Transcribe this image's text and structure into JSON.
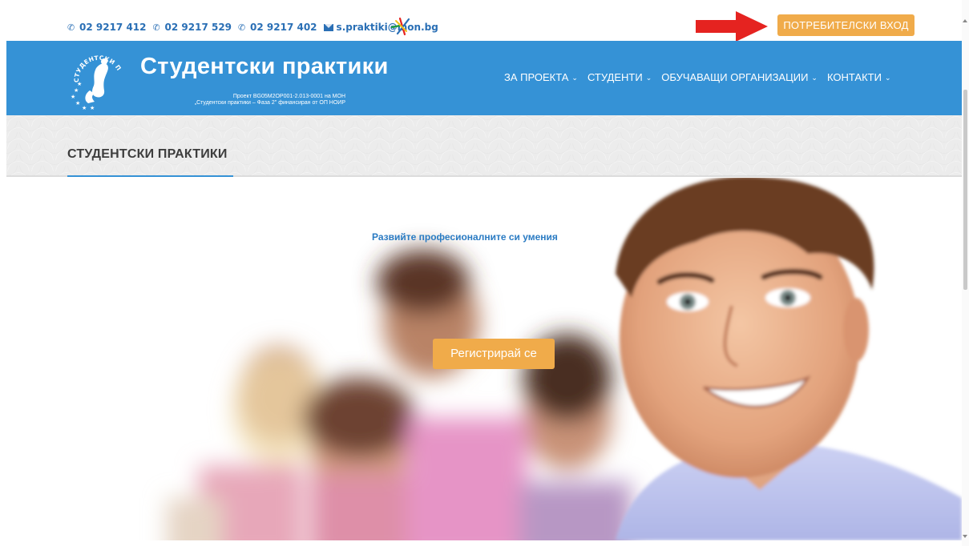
{
  "topbar": {
    "phones": [
      "02 9217 412",
      "02 9217 529",
      "02 9217 402"
    ],
    "email": "s.praktiki@mon.bg",
    "login_label": "ПОТРЕБИТЕЛСКИ ВХОД"
  },
  "header": {
    "title": "Студентски практики",
    "subtitle_line1": "Проект BG05M2OP001-2.013-0001 на МОН",
    "subtitle_line2": "„Студентски практики – Фаза 2\" финансиран от ОП НОИР",
    "logo_text": "СТУДЕНТСКИ ПРАКТИКИ",
    "nav": [
      {
        "label": "ЗА ПРОЕКТА"
      },
      {
        "label": "СТУДЕНТИ"
      },
      {
        "label": "ОБУЧАВАЩИ ОРГАНИЗАЦИИ"
      },
      {
        "label": "КОНТАКТИ"
      }
    ]
  },
  "page_band": {
    "title": "СТУДЕНТСКИ ПРАКТИКИ"
  },
  "hero": {
    "tagline": "Развийте професионалните си умения",
    "register_label": "Регистрирай се"
  },
  "colors": {
    "brand_blue": "#3592d6",
    "accent_orange": "#f0ab4a",
    "link_blue": "#2a6fb5",
    "arrow_red": "#e52320"
  },
  "icons": [
    "phone-icon",
    "envelope-icon",
    "eu-funds-icon",
    "chevron-down-icon",
    "red-arrow-icon"
  ]
}
